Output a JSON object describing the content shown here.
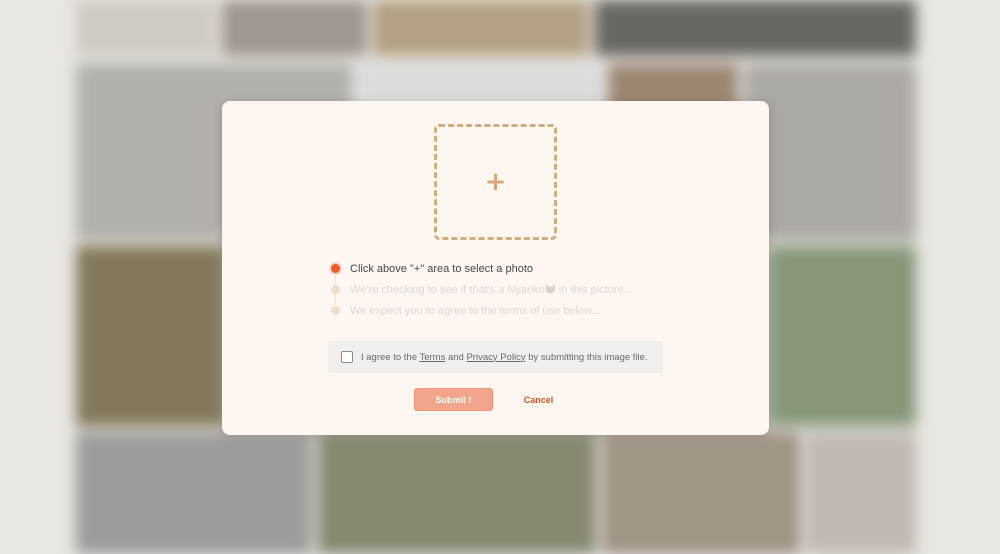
{
  "upload": {
    "icon": "plus-icon",
    "glyph": "+"
  },
  "steps": [
    {
      "label": "Click above \"+\" area to select a photo",
      "status": "active"
    },
    {
      "label_before": "We're checking to see if that's a Nyanko",
      "icon": "cat-icon",
      "label_after": " in this picture...",
      "status": "pending"
    },
    {
      "label": "We expect you to agree to the terms of use below...",
      "status": "pending"
    }
  ],
  "agreement": {
    "prefix": "I agree to the ",
    "terms_link": "Terms",
    "middle": " and ",
    "privacy_link": "Privacy Policy",
    "suffix": " by submitting this image file.",
    "checked": false
  },
  "buttons": {
    "submit": "Submit !",
    "cancel": "Cancel"
  },
  "colors": {
    "accent": "#e95b2d",
    "submit_bg": "#f2a58a",
    "dashed_border": "#d2ad7f",
    "modal_bg": "#fdf6f1"
  }
}
